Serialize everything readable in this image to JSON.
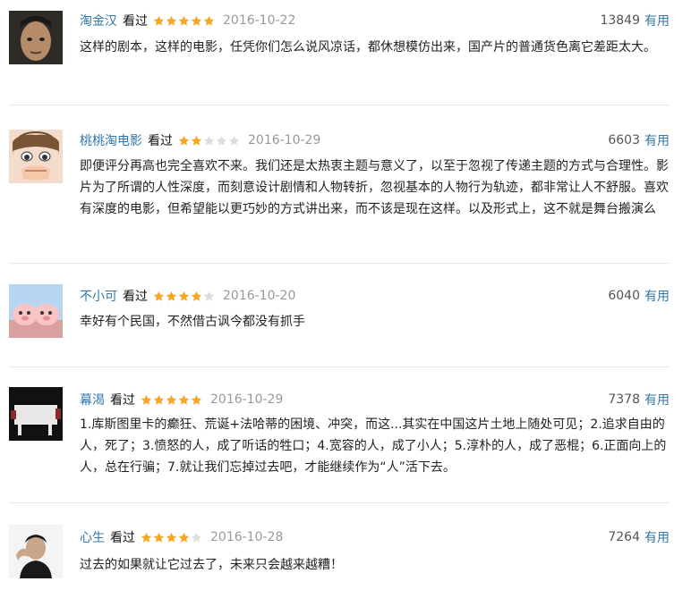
{
  "reviews": [
    {
      "user": "淘金汉",
      "status": "看过",
      "rating": 5,
      "date": "2016-10-22",
      "votes": "13849",
      "useful_label": "有用",
      "text": "这样的剧本，这样的电影，任凭你们怎么说风凉话，都休想模仿出来，国产片的普通货色离它差距太大。"
    },
    {
      "user": "桃桃淘电影",
      "status": "看过",
      "rating": 2,
      "date": "2016-10-29",
      "votes": "6603",
      "useful_label": "有用",
      "text": "即便评分再高也完全喜欢不来。我们还是太热衷主题与意义了，以至于忽视了传递主题的方式与合理性。影片为了所谓的人性深度，而刻意设计剧情和人物转折，忽视基本的人物行为轨迹，都非常让人不舒服。喜欢有深度的电影，但希望能以更巧妙的方式讲出来，而不该是现在这样。以及形式上，这不就是舞台搬演么"
    },
    {
      "user": "不小可",
      "status": "看过",
      "rating": 4,
      "date": "2016-10-20",
      "votes": "6040",
      "useful_label": "有用",
      "text": "幸好有个民国，不然借古讽今都没有抓手"
    },
    {
      "user": "幕渴",
      "status": "看过",
      "rating": 5,
      "date": "2016-10-29",
      "votes": "7378",
      "useful_label": "有用",
      "text": "1.库斯图里卡的癫狂、荒诞+法哈蒂的困境、冲突，而这...其实在中国这片土地上随处可见；2.追求自由的人，死了；3.愤怒的人，成了听话的牲口；4.宽容的人，成了小人；5.淳朴的人，成了恶棍；6.正面向上的人，总在行骗；7.就让我们忘掉过去吧，才能继续作为“人”活下去。"
    },
    {
      "user": "心生",
      "status": "看过",
      "rating": 4,
      "date": "2016-10-28",
      "votes": "7264",
      "useful_label": "有用",
      "text": "过去的如果就让它过去了，未来只会越来越糟！"
    }
  ],
  "colors": {
    "link": "#3377aa",
    "star_on": "#f5a623",
    "star_off": "#dddddd",
    "date": "#999999"
  },
  "icons": {
    "star": "star-icon",
    "avatar": "user-avatar-image"
  }
}
